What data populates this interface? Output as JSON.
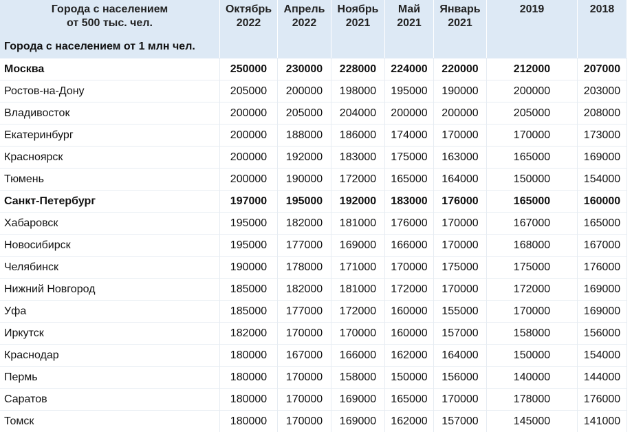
{
  "table": {
    "header": {
      "city_line1": "Города с населением",
      "city_line2": "от 500 тыс. чел.",
      "columns": [
        {
          "line1": "Октябрь",
          "line2": "2022"
        },
        {
          "line1": "Апрель",
          "line2": "2022"
        },
        {
          "line1": "Ноябрь",
          "line2": "2021"
        },
        {
          "line1": "Май",
          "line2": "2021"
        },
        {
          "line1": "Январь",
          "line2": "2021"
        },
        {
          "line1": "2019",
          "line2": ""
        },
        {
          "line1": "2018",
          "line2": ""
        }
      ],
      "section_label": "Города с населением от 1 млн чел."
    },
    "rows": [
      {
        "city": "Москва",
        "bold": true,
        "values": [
          "250000",
          "230000",
          "228000",
          "224000",
          "220000",
          "212000",
          "207000"
        ]
      },
      {
        "city": "Ростов-на-Дону",
        "bold": false,
        "values": [
          "205000",
          "200000",
          "198000",
          "195000",
          "190000",
          "200000",
          "203000"
        ]
      },
      {
        "city": "Владивосток",
        "bold": false,
        "values": [
          "200000",
          "205000",
          "204000",
          "200000",
          "200000",
          "205000",
          "208000"
        ]
      },
      {
        "city": "Екатеринбург",
        "bold": false,
        "values": [
          "200000",
          "188000",
          "186000",
          "174000",
          "170000",
          "170000",
          "173000"
        ]
      },
      {
        "city": "Красноярск",
        "bold": false,
        "values": [
          "200000",
          "192000",
          "183000",
          "175000",
          "163000",
          "165000",
          "169000"
        ]
      },
      {
        "city": "Тюмень",
        "bold": false,
        "values": [
          "200000",
          "190000",
          "172000",
          "165000",
          "164000",
          "150000",
          "154000"
        ]
      },
      {
        "city": "Санкт-Петербург",
        "bold": true,
        "values": [
          "197000",
          "195000",
          "192000",
          "183000",
          "176000",
          "165000",
          "160000"
        ]
      },
      {
        "city": "Хабаровск",
        "bold": false,
        "values": [
          "195000",
          "182000",
          "181000",
          "176000",
          "170000",
          "167000",
          "165000"
        ]
      },
      {
        "city": "Новосибирск",
        "bold": false,
        "values": [
          "195000",
          "177000",
          "169000",
          "166000",
          "170000",
          "168000",
          "167000"
        ]
      },
      {
        "city": "Челябинск",
        "bold": false,
        "values": [
          "190000",
          "178000",
          "171000",
          "170000",
          "175000",
          "175000",
          "176000"
        ]
      },
      {
        "city": "Нижний Новгород",
        "bold": false,
        "values": [
          "185000",
          "182000",
          "181000",
          "172000",
          "170000",
          "172000",
          "169000"
        ]
      },
      {
        "city": "Уфа",
        "bold": false,
        "values": [
          "185000",
          "177000",
          "172000",
          "160000",
          "155000",
          "170000",
          "169000"
        ]
      },
      {
        "city": "Иркутск",
        "bold": false,
        "values": [
          "182000",
          "170000",
          "170000",
          "160000",
          "157000",
          "158000",
          "156000"
        ]
      },
      {
        "city": "Краснодар",
        "bold": false,
        "values": [
          "180000",
          "167000",
          "166000",
          "162000",
          "164000",
          "150000",
          "154000"
        ]
      },
      {
        "city": "Пермь",
        "bold": false,
        "values": [
          "180000",
          "170000",
          "158000",
          "150000",
          "156000",
          "140000",
          "144000"
        ]
      },
      {
        "city": "Саратов",
        "bold": false,
        "values": [
          "180000",
          "170000",
          "169000",
          "165000",
          "170000",
          "178000",
          "176000"
        ]
      },
      {
        "city": "Томск",
        "bold": false,
        "values": [
          "180000",
          "170000",
          "169000",
          "162000",
          "157000",
          "145000",
          "141000"
        ]
      }
    ]
  }
}
